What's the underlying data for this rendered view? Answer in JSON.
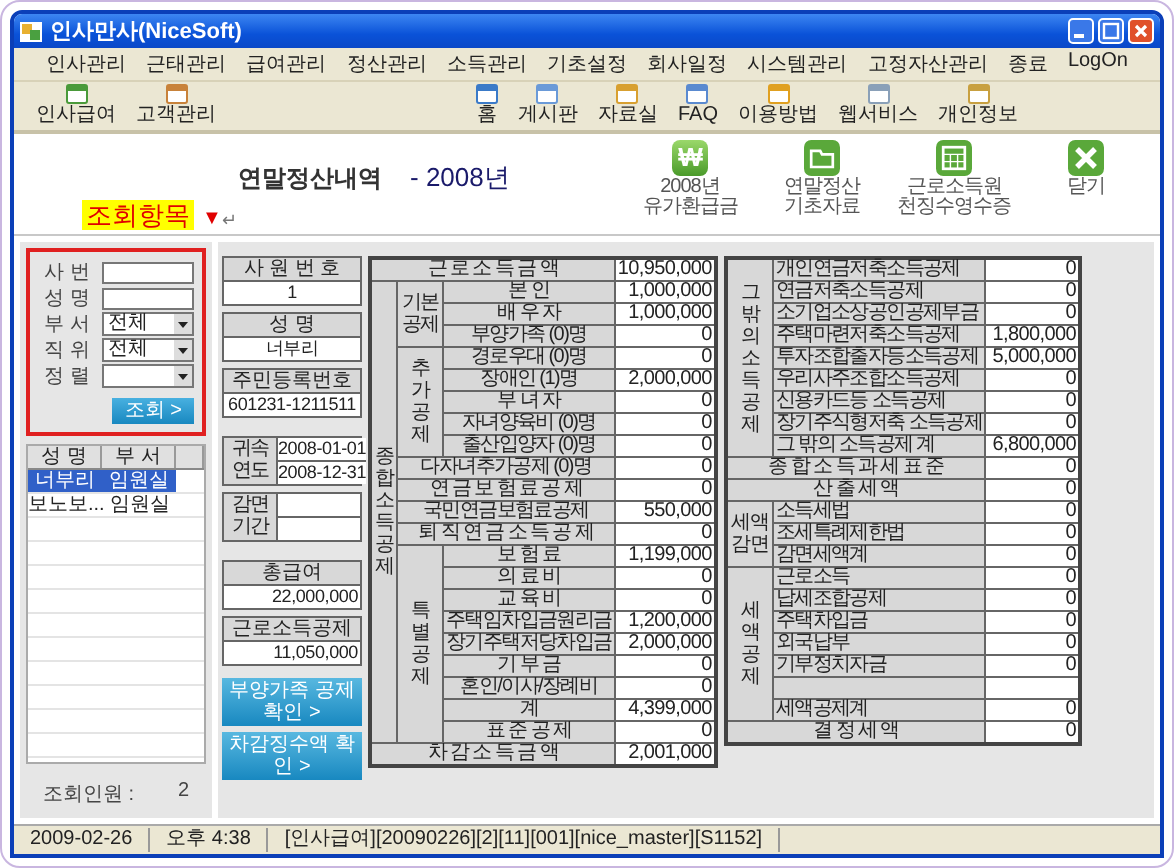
{
  "window": {
    "title": "인사만사(NiceSoft)"
  },
  "menu": [
    "인사관리",
    "근태관리",
    "급여관리",
    "정산관리",
    "소득관리",
    "기초설정",
    "회사일정",
    "시스템관리",
    "고정자산관리",
    "종료",
    "LogOn"
  ],
  "toolbar": {
    "left": [
      {
        "label": "인사급여"
      },
      {
        "label": "고객관리"
      }
    ],
    "right": [
      {
        "label": "홈"
      },
      {
        "label": "게시판"
      },
      {
        "label": "자료실"
      },
      {
        "label": "FAQ"
      },
      {
        "label": "이용방법"
      },
      {
        "label": "웹서비스"
      },
      {
        "label": "개인정보"
      }
    ]
  },
  "header": {
    "title": "연말정산내역",
    "year": "- 2008년",
    "annotation": "조회항목",
    "annotation_marker": "▼",
    "return_mark": "↵",
    "actions": [
      {
        "kind": "glyph",
        "glyph": "₩",
        "lines": [
          "2008년",
          "유가환급금"
        ]
      },
      {
        "kind": "folder",
        "lines": [
          "연말정산",
          "기초자료"
        ]
      },
      {
        "kind": "calendar",
        "lines": [
          "근로소득원",
          "천징수영수증"
        ]
      },
      {
        "kind": "close",
        "lines": [
          "닫기"
        ]
      }
    ]
  },
  "search": {
    "fields": [
      {
        "kind": "text",
        "label": "사 번"
      },
      {
        "kind": "text",
        "label": "성 명"
      },
      {
        "kind": "select",
        "label": "부 서",
        "value": "전체"
      },
      {
        "kind": "select",
        "label": "직 위",
        "value": "전체"
      },
      {
        "kind": "select",
        "label": "정 렬"
      }
    ],
    "button": "조회 >"
  },
  "employee_list": {
    "columns": [
      "성 명",
      "부 서"
    ],
    "rows": [
      {
        "name": "너부리",
        "department": "임원실",
        "selected": true
      },
      {
        "name": "보노보...",
        "department": "임원실",
        "selected": false
      }
    ],
    "count_label": "조회인원 :",
    "count": "2"
  },
  "info": {
    "groups": [
      [
        {
          "kind": "field",
          "label": "사 원 번 호",
          "value": "1"
        },
        {
          "kind": "field",
          "label": "성 명",
          "value": "너부리"
        },
        {
          "kind": "field",
          "label": "주민등록번호",
          "value": "601231-1211511"
        }
      ],
      [
        {
          "kind": "period",
          "label": "귀속연도",
          "values": [
            "2008-01-01",
            "2008-12-31"
          ]
        },
        {
          "kind": "period",
          "label": "감면기간"
        }
      ],
      [
        {
          "kind": "field",
          "label": "총급여",
          "value": "22,000,000"
        },
        {
          "kind": "field",
          "label": "근로소득공제",
          "value": "11,050,000"
        }
      ]
    ],
    "buttons": [
      "부양가족 공제 확인 >",
      "차감징수액 확인 >"
    ]
  },
  "deductions_table": {
    "rows": [
      {
        "kind": "row",
        "label": "근 로 소 득 금 액",
        "value": "10,950,000"
      },
      {
        "kind": "group",
        "label": "종합소득공제",
        "children": [
          {
            "kind": "group",
            "label": "기본공제",
            "children": [
              {
                "kind": "row",
                "label": "본 인",
                "value": "1,000,000"
              },
              {
                "kind": "row",
                "label": "배 우 자",
                "value": "1,000,000"
              },
              {
                "kind": "row",
                "label": "부양가족 (0)명",
                "value": "0"
              }
            ]
          },
          {
            "kind": "group",
            "label": "추가공제",
            "children": [
              {
                "kind": "row",
                "label": "경로우대 (0)명",
                "value": "0"
              },
              {
                "kind": "row",
                "label": "장애인 (1)명",
                "value": "2,000,000"
              },
              {
                "kind": "row",
                "label": "부 녀 자",
                "value": "0"
              },
              {
                "kind": "row",
                "label": "자녀양육비 (0)명",
                "value": "0"
              },
              {
                "kind": "row",
                "label": "출산입양자 (0)명",
                "value": "0"
              }
            ]
          },
          {
            "kind": "row",
            "label": "다자녀추가공제 (0)명",
            "value": "0"
          },
          {
            "kind": "row",
            "label": "연 금 보 험 료 공 제",
            "value": "0"
          },
          {
            "kind": "row",
            "label": "국민연금보험료공제",
            "value": "550,000"
          },
          {
            "kind": "row",
            "label": "퇴 직 연 금 소 득 공 제",
            "value": "0"
          },
          {
            "kind": "group",
            "label": "특별공제",
            "children": [
              {
                "kind": "row",
                "label": "보 험 료",
                "value": "1,199,000"
              },
              {
                "kind": "row",
                "label": "의 료 비",
                "value": "0"
              },
              {
                "kind": "row",
                "label": "교 육 비",
                "value": "0"
              },
              {
                "kind": "row",
                "label": "주택임차입금원리금",
                "value": "1,200,000"
              },
              {
                "kind": "row",
                "label": "장기주택저당차입금",
                "value": "2,000,000"
              },
              {
                "kind": "row",
                "label": "기 부 금",
                "value": "0"
              },
              {
                "kind": "row",
                "label": "혼인/이사/장례비",
                "value": "0"
              },
              {
                "kind": "row",
                "label": "계",
                "value": "4,399,000"
              },
              {
                "kind": "row",
                "label": "표 준 공 제",
                "value": "0"
              }
            ]
          }
        ]
      },
      {
        "kind": "row",
        "label": "차 감 소 득 금 액",
        "value": "2,001,000"
      }
    ]
  },
  "tax_table": {
    "rows": [
      {
        "kind": "group",
        "label": "그밖의소득공제",
        "children": [
          {
            "kind": "row",
            "label": "개인연금저축소득공제",
            "value": "0"
          },
          {
            "kind": "row",
            "label": "연금저축소득공제",
            "value": "0"
          },
          {
            "kind": "row",
            "label": "소기업소상공인공제부금",
            "value": "0"
          },
          {
            "kind": "row",
            "label": "주택마련저축소득공제",
            "value": "1,800,000"
          },
          {
            "kind": "row",
            "label": "투자조합출자등소득공제",
            "value": "5,000,000"
          },
          {
            "kind": "row",
            "label": "우리사주조합소득공제",
            "value": "0"
          },
          {
            "kind": "row",
            "label": "신용카드등 소득공제",
            "value": "0"
          },
          {
            "kind": "row",
            "label": "장기주식형저축 소득공제",
            "value": "0"
          },
          {
            "kind": "row",
            "label": "그 밖의 소득공제 계",
            "value": "6,800,000"
          }
        ]
      },
      {
        "kind": "row",
        "label": "종 합 소 득 과 세 표 준",
        "value": "0"
      },
      {
        "kind": "row",
        "label": "산 출 세 액",
        "value": "0"
      },
      {
        "kind": "group",
        "label": "세액감면",
        "children": [
          {
            "kind": "row",
            "label": "소득세법",
            "value": "0"
          },
          {
            "kind": "row",
            "label": "조세특례제한법",
            "value": "0"
          },
          {
            "kind": "row",
            "label": "감면세액계",
            "value": "0"
          }
        ]
      },
      {
        "kind": "group",
        "label": "세액공제",
        "children": [
          {
            "kind": "row",
            "label": "근로소득",
            "value": "0"
          },
          {
            "kind": "row",
            "label": "납세조합공제",
            "value": "0"
          },
          {
            "kind": "row",
            "label": "주택차입금",
            "value": "0"
          },
          {
            "kind": "row",
            "label": "외국납부",
            "value": "0"
          },
          {
            "kind": "row",
            "label": "기부정치자금",
            "value": "0"
          },
          {
            "kind": "blank"
          },
          {
            "kind": "row",
            "label": "세액공제계",
            "value": "0"
          }
        ]
      },
      {
        "kind": "row",
        "label": "결 정 세 액",
        "value": "0"
      }
    ]
  },
  "status_bar": [
    "2009-02-26",
    "오후 4:38",
    "[인사급여][20090226][2][11][001][nice_master][S1152]"
  ]
}
